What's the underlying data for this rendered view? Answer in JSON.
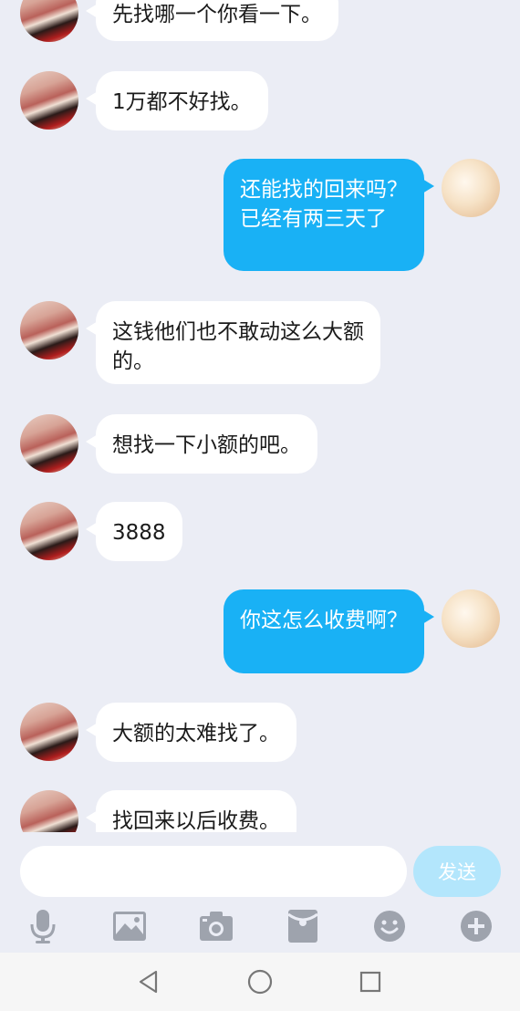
{
  "messages": [
    {
      "side": "in",
      "text": "先找哪一个你看一下。"
    },
    {
      "side": "in",
      "text": "1万都不好找。"
    },
    {
      "side": "out",
      "text": "还能找的回来吗？\n已经有两三天了"
    },
    {
      "side": "in",
      "text": "这钱他们也不敢动这么大额\n的。"
    },
    {
      "side": "in",
      "text": "想找一下小额的吧。"
    },
    {
      "side": "in",
      "text": "3888"
    },
    {
      "side": "out",
      "text": "你这怎么收费啊？"
    },
    {
      "side": "in",
      "text": "大额的太难找了。"
    },
    {
      "side": "in",
      "text": "找回来以后收费。"
    }
  ],
  "composer": {
    "input_value": "",
    "send_label": "发送",
    "tools": [
      "microphone-icon",
      "image-icon",
      "camera-icon",
      "red-packet-icon",
      "emoji-icon",
      "plus-icon"
    ]
  },
  "navbar": {
    "buttons": [
      "back-icon",
      "home-icon",
      "recents-icon"
    ]
  },
  "colors": {
    "background": "#ebedf5",
    "incoming_bubble": "#ffffff",
    "outgoing_bubble": "#19b1f5",
    "send_button_disabled": "#b3e6fc",
    "icon_gray": "#9ea3ad"
  }
}
